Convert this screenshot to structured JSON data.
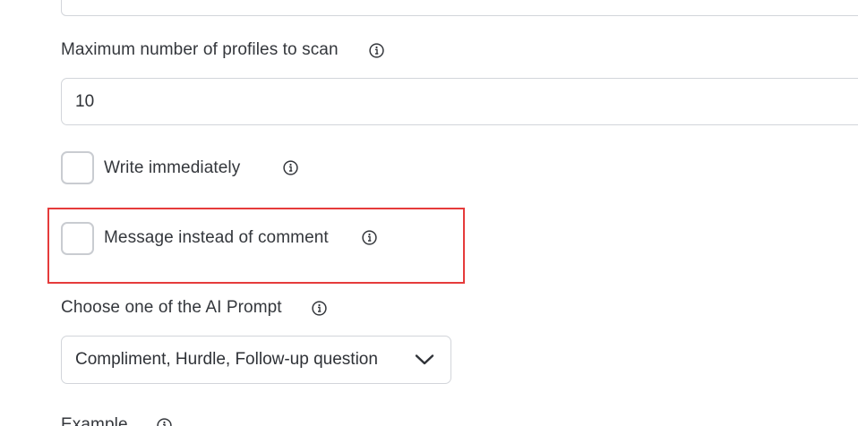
{
  "fields": {
    "max_profiles": {
      "label": "Maximum number of profiles to scan",
      "value": "10",
      "info_icon": "info-circle-icon"
    },
    "write_immediately": {
      "label": "Write immediately",
      "checked": false,
      "info_icon": "info-circle-icon"
    },
    "message_instead": {
      "label": "Message instead of comment",
      "checked": false,
      "info_icon": "info-circle-icon"
    },
    "ai_prompt": {
      "label": "Choose one of the AI Prompt",
      "selected": "Compliment, Hurdle, Follow-up question",
      "dropdown_icon": "chevron-down-icon",
      "info_icon": "info-circle-icon"
    },
    "example": {
      "label": "Example",
      "info_icon": "info-circle-icon"
    }
  },
  "colors": {
    "highlight_border": "#e53b3b",
    "input_border": "#d2d5da",
    "checkbox_border": "#c9ccd1",
    "text": "#34373c"
  }
}
